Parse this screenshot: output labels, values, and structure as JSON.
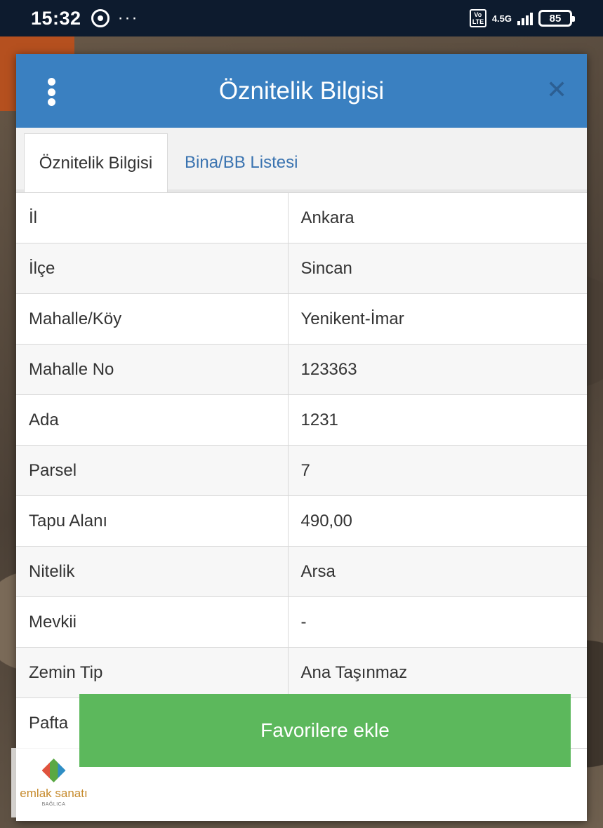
{
  "status_bar": {
    "time": "15:32",
    "more": "···",
    "volte": "Vo LTE",
    "network": "4.5G",
    "battery": "85"
  },
  "dialog": {
    "title": "Öznitelik Bilgisi",
    "close": "✕",
    "header_color": "#3a80c1"
  },
  "tabs": [
    {
      "label": "Öznitelik Bilgisi",
      "active": true
    },
    {
      "label": "Bina/BB Listesi",
      "active": false
    }
  ],
  "attributes": [
    {
      "key": "İl",
      "value": "Ankara"
    },
    {
      "key": "İlçe",
      "value": "Sincan"
    },
    {
      "key": "Mahalle/Köy",
      "value": "Yenikent-İmar"
    },
    {
      "key": "Mahalle No",
      "value": "123363"
    },
    {
      "key": "Ada",
      "value": "1231"
    },
    {
      "key": "Parsel",
      "value": "7"
    },
    {
      "key": "Tapu Alanı",
      "value": "490,00"
    },
    {
      "key": "Nitelik",
      "value": "Arsa"
    },
    {
      "key": "Mevkii",
      "value": "-"
    },
    {
      "key": "Zemin Tip",
      "value": "Ana Taşınmaz"
    },
    {
      "key": "Pafta",
      "value": "-"
    }
  ],
  "actions": {
    "favorite_label": "Favorilere ekle",
    "favorite_color": "#5cb85c"
  },
  "watermark_logo": {
    "name": "emlak sanatı",
    "sub": "BAĞLICA"
  }
}
